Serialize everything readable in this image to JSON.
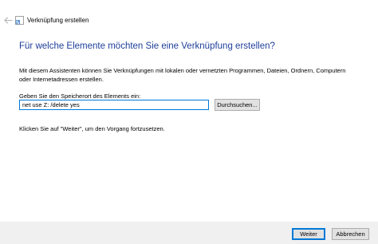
{
  "window": {
    "title": "Verknüpfung erstellen"
  },
  "icons": {
    "back": "back-arrow-icon",
    "app": "shortcut-icon"
  },
  "main": {
    "heading": "Für welche Elemente möchten Sie eine Verknüpfung erstellen?",
    "intro": "Mit diesem Assistenten können Sie Verknüpfungen mit lokalen oder vernetzten Programmen, Dateien, Ordnern, Computern oder Internetadressen erstellen.",
    "field_label": "Geben Sie den Speicherort des Elements ein:",
    "location_value": "net use Z: /delete yes",
    "browse_label": "Durchsuchen...",
    "hint": "Klicken Sie auf \"Weiter\", um den Vorgang fortzusetzen."
  },
  "footer": {
    "next_label": "Weiter",
    "cancel_label": "Abbrechen"
  },
  "colors": {
    "heading": "#1e3f9a",
    "accent": "#0078d7",
    "footer_bg": "#f0f0f0",
    "button_bg": "#e1e1e1"
  }
}
